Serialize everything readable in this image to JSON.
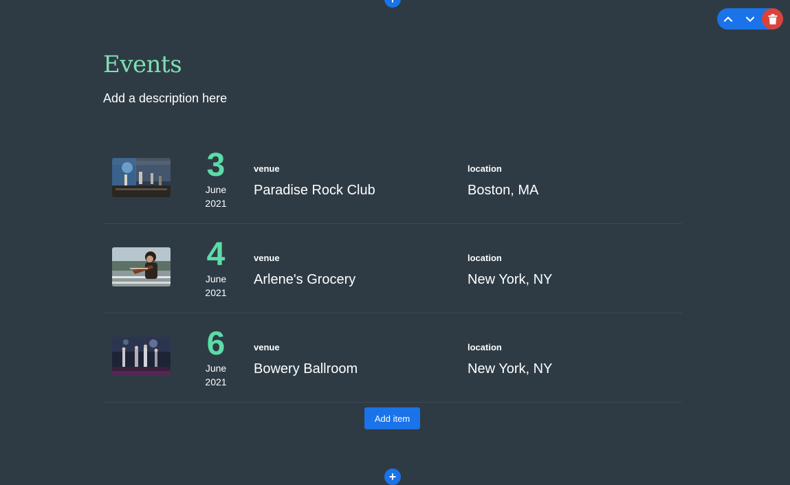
{
  "section": {
    "title": "Events",
    "description": "Add a description here",
    "add_item_label": "Add item"
  },
  "controls": {
    "icons": [
      "chevron-up-icon",
      "chevron-down-icon",
      "trash-icon"
    ],
    "accent": "#1a73e8",
    "danger": "#d9433b"
  },
  "colors": {
    "background": "#2e3b45",
    "title": "#7ee0b2",
    "day": "#5cdca6"
  },
  "events": [
    {
      "day": "3",
      "month": "June",
      "year": "2021",
      "venue_label": "venue",
      "venue": "Paradise Rock Club",
      "location_label": "location",
      "location": "Boston, MA"
    },
    {
      "day": "4",
      "month": "June",
      "year": "2021",
      "venue_label": "venue",
      "venue": "Arlene's Grocery",
      "location_label": "location",
      "location": "New York, NY"
    },
    {
      "day": "6",
      "month": "June",
      "year": "2021",
      "venue_label": "venue",
      "venue": "Bowery Ballroom",
      "location_label": "location",
      "location": "New York, NY"
    }
  ]
}
